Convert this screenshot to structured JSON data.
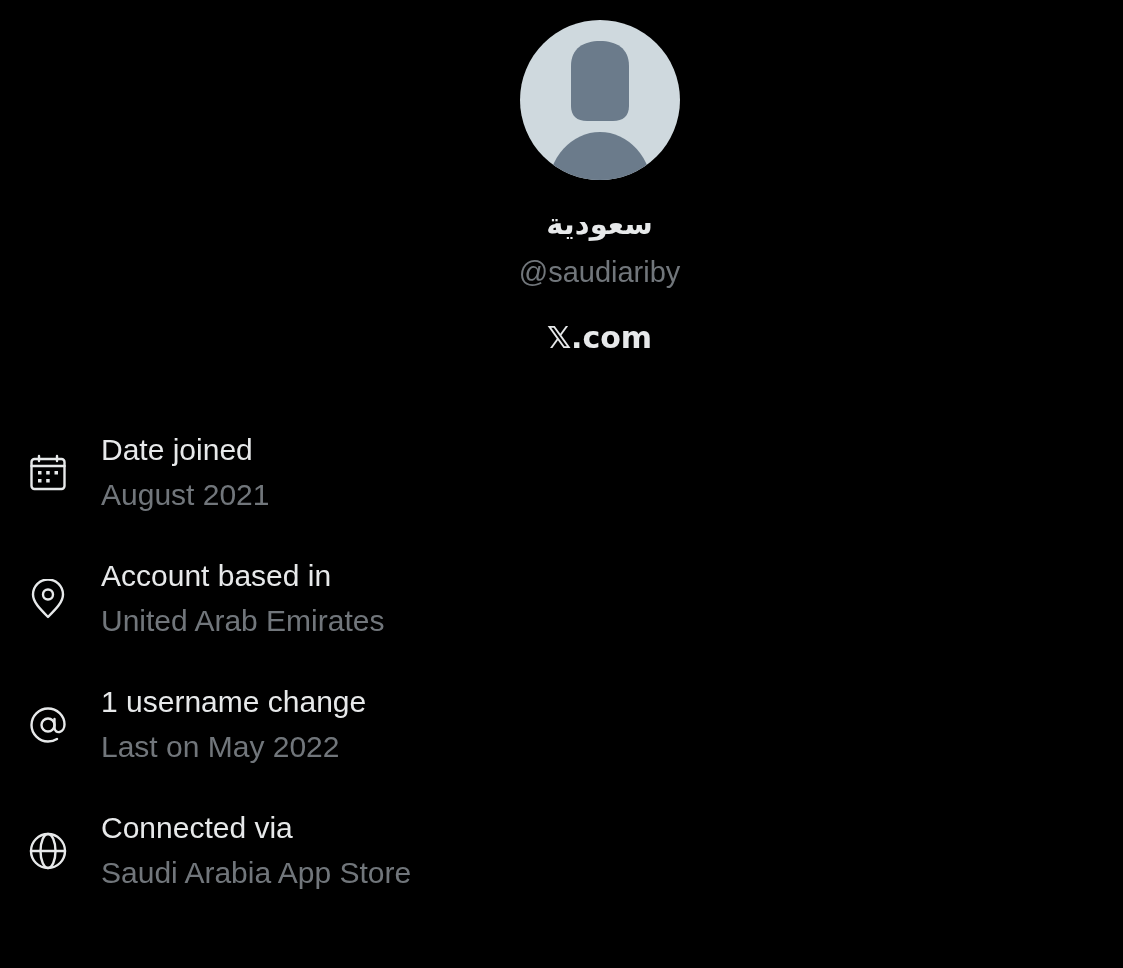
{
  "profile": {
    "display_name": "سعودية",
    "handle": "@saudiariby",
    "site": "𝕏.com"
  },
  "details": [
    {
      "kind": "calendar",
      "label": "Date joined",
      "value": "August 2021"
    },
    {
      "kind": "location",
      "label": "Account based in",
      "value": "United Arab Emirates"
    },
    {
      "kind": "at",
      "label": "1 username change",
      "value": "Last on May 2022"
    },
    {
      "kind": "globe",
      "label": "Connected via",
      "value": "Saudi Arabia App Store"
    }
  ]
}
